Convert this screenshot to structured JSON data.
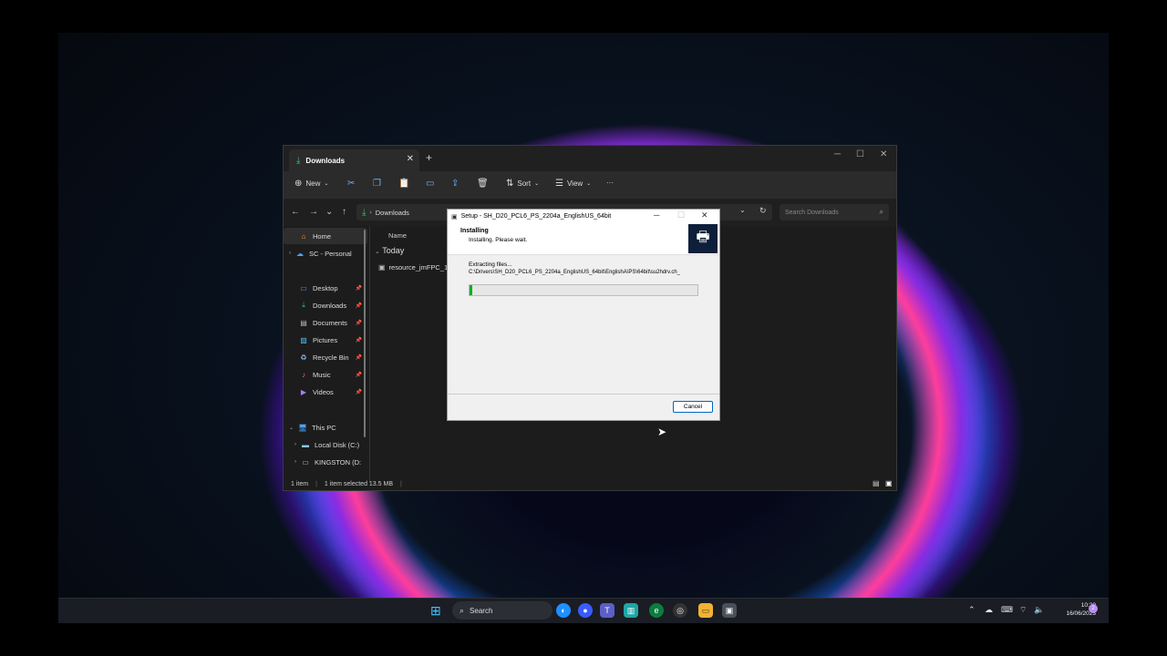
{
  "explorer": {
    "tab_title": "Downloads",
    "new_tab": "+",
    "toolbar": {
      "new_label": "New",
      "sort_label": "Sort",
      "view_label": "View",
      "more_label": "···"
    },
    "address": "Downloads",
    "search_placeholder": "Search Downloads",
    "sidebar": [
      {
        "label": "Home",
        "icon": "home-icon"
      },
      {
        "label": "SC - Personal",
        "icon": "cloud-icon"
      },
      {
        "label": "Desktop",
        "icon": "desktop-icon"
      },
      {
        "label": "Downloads",
        "icon": "download-icon"
      },
      {
        "label": "Documents",
        "icon": "documents-icon"
      },
      {
        "label": "Pictures",
        "icon": "pictures-icon"
      },
      {
        "label": "Recycle Bin",
        "icon": "recycle-bin-icon"
      },
      {
        "label": "Music",
        "icon": "music-icon"
      },
      {
        "label": "Videos",
        "icon": "videos-icon"
      },
      {
        "label": "This PC",
        "icon": "pc-icon"
      },
      {
        "label": "Local Disk (C:)",
        "icon": "disk-icon"
      },
      {
        "label": "KINGSTON (D:",
        "icon": "usb-drive-icon"
      }
    ],
    "column_name": "Name",
    "group_today": "Today",
    "file_name": "resource_jmFPC_16",
    "status": {
      "items": "1 item",
      "selected": "1 item selected  13.5 MB"
    }
  },
  "setup": {
    "title": "Setup - SH_D20_PCL6_PS_2204a_EnglishUS_64bit",
    "heading": "Installing",
    "subheading": "Installing.  Please wait.",
    "extracting": "Extracting files...",
    "path": "C:\\Drivers\\SH_D20_PCL6_PS_2204a_EnglishUS_64bit\\EnglishA\\PS\\64bit\\su2hdrv.ch_",
    "progress": 0.01,
    "cancel_label": "Cancel"
  },
  "taskbar": {
    "search_label": "Search",
    "time": "10:20",
    "date": "16/06/2023"
  }
}
